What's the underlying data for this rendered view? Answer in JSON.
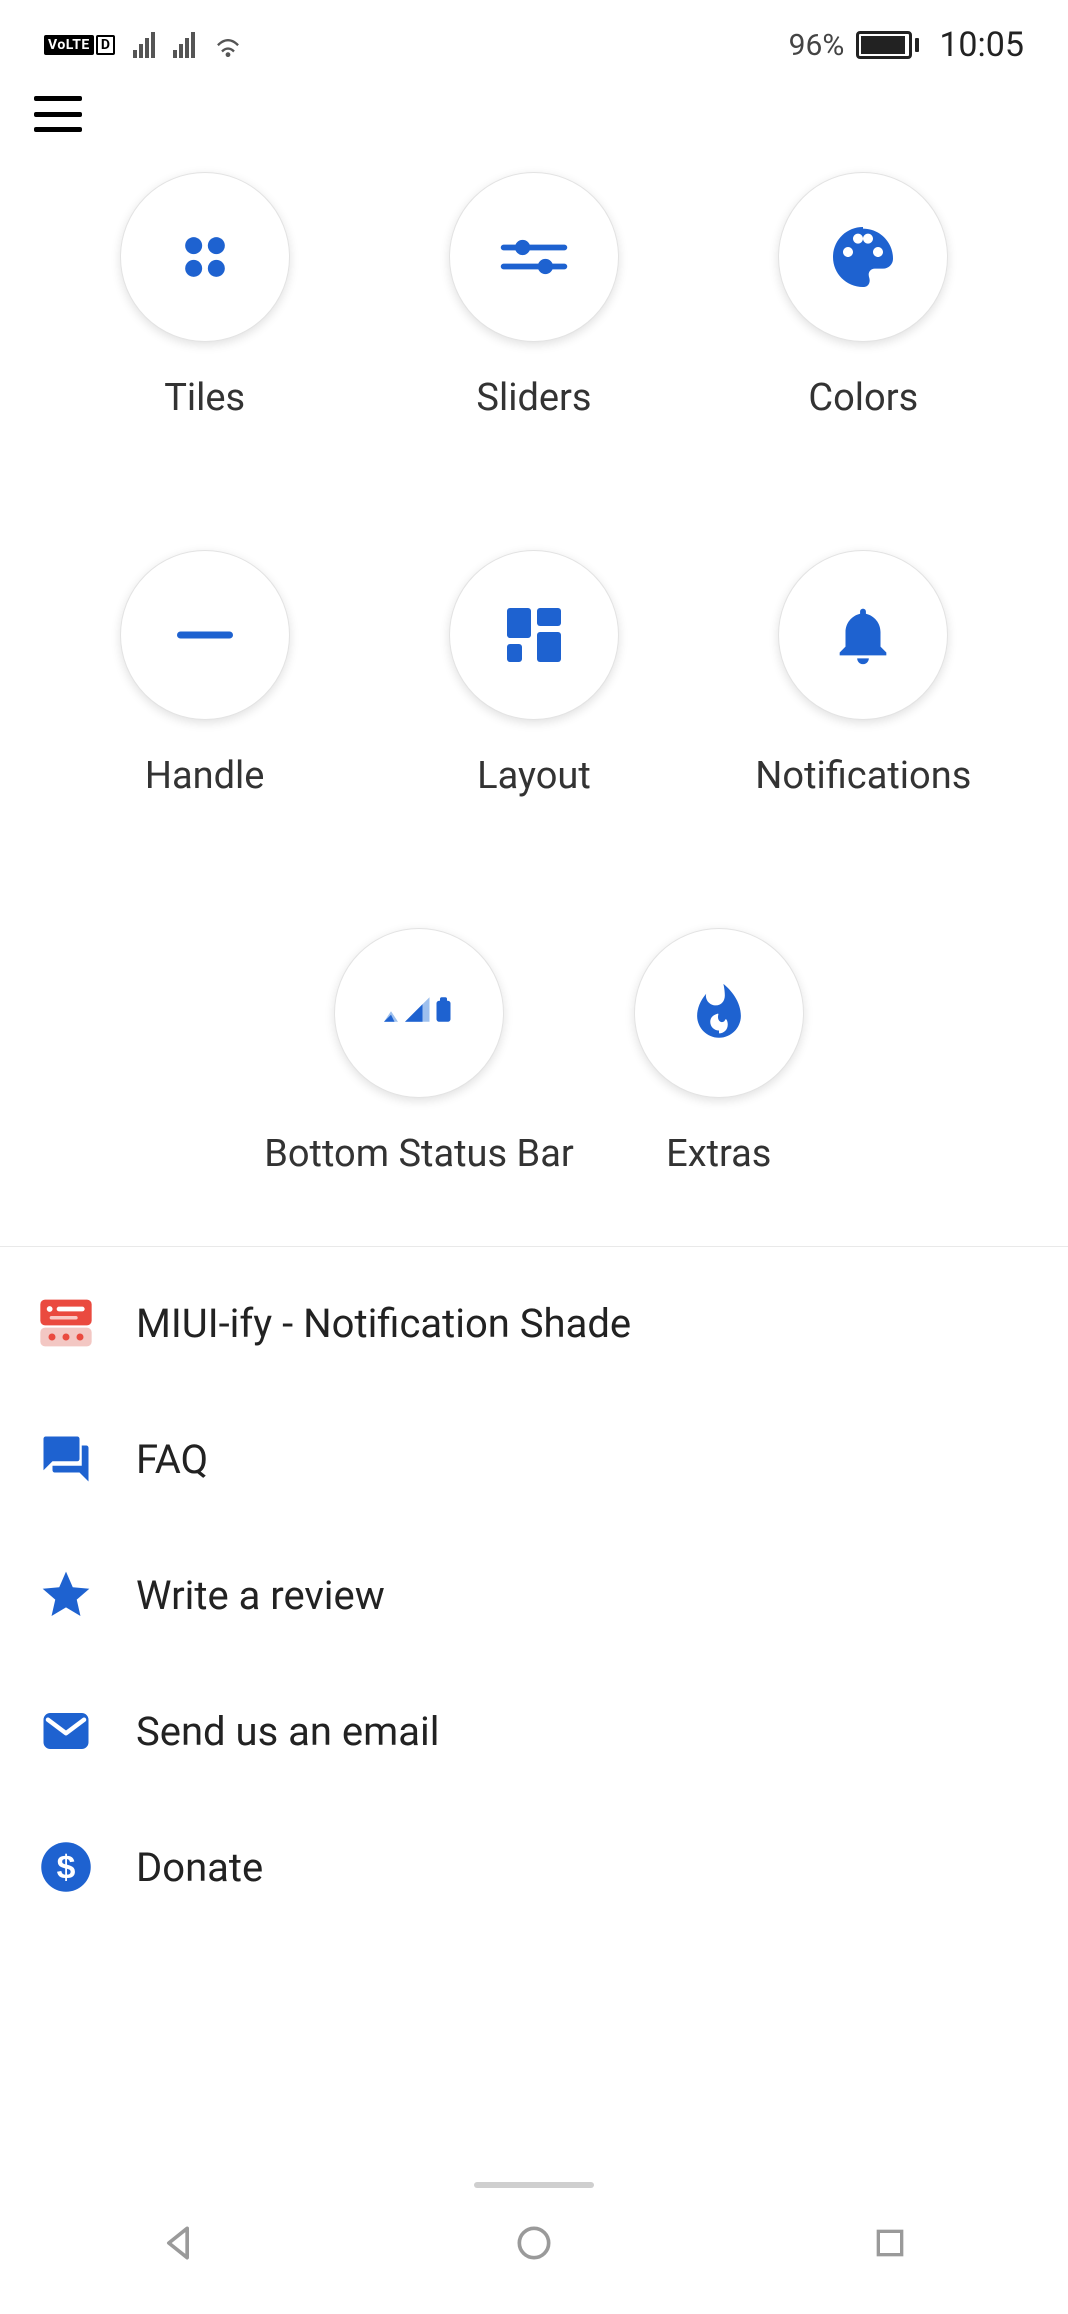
{
  "status": {
    "volte_label": "VoLTE",
    "volte_sub": "D",
    "battery_pct": "96%",
    "time": "10:05"
  },
  "grid": {
    "tiles": "Tiles",
    "sliders": "Sliders",
    "colors": "Colors",
    "handle": "Handle",
    "layout": "Layout",
    "notifications": "Notifications",
    "bottom_status_bar": "Bottom Status Bar",
    "extras": "Extras"
  },
  "list": {
    "miui": "MIUI-ify - Notification Shade",
    "faq": "FAQ",
    "review": "Write a review",
    "email": "Send us an email",
    "donate": "Donate"
  },
  "colors": {
    "accent": "#1e62d0",
    "miui_red": "#ea4a3f"
  }
}
